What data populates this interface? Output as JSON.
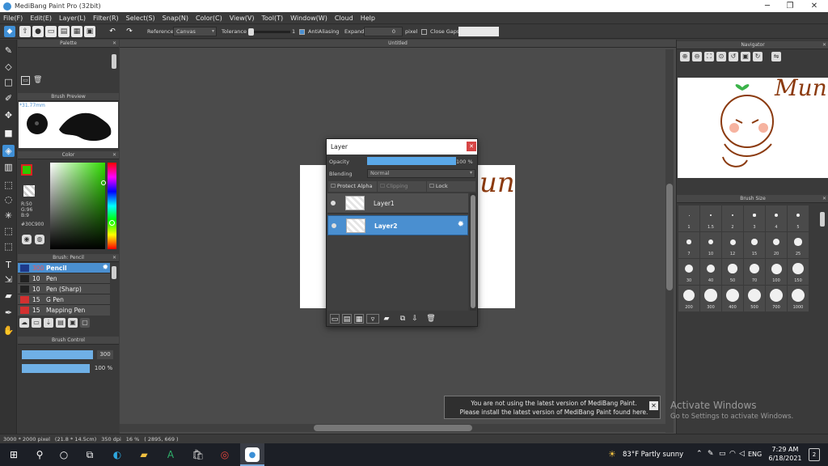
{
  "window": {
    "title": "MediBang Paint Pro (32bit)",
    "minimize": "─",
    "restore": "❐",
    "close": "✕"
  },
  "menu": [
    "File(F)",
    "Edit(E)",
    "Layer(L)",
    "Filter(R)",
    "Select(S)",
    "Snap(N)",
    "Color(C)",
    "View(V)",
    "Tool(T)",
    "Window(W)",
    "Cloud",
    "Help"
  ],
  "toolbar": {
    "reference_label": "Reference",
    "reference_value": "Canvas",
    "tolerance_label": "Tolerance",
    "tolerance_value": "1",
    "antialiasing_label": "AntiAliasing",
    "expand_label": "Expand",
    "expand_value": "0",
    "pixel_label": "pixel",
    "close_gaps_label": "Close Gaps"
  },
  "panels": {
    "palette": "Palette",
    "brush_preview": "Brush Preview",
    "brush_preview_size": "*31.77mm",
    "color": "Color",
    "color_values": {
      "r": "R:50",
      "g": "G:96",
      "b": "B:9",
      "hex": "#30C900"
    },
    "brush": "Brush: Pencil",
    "brush_control": "Brush Control",
    "navigator": "Navigator",
    "brush_size": "Brush Size",
    "untitled": "Untitled"
  },
  "brushes": [
    {
      "size": "300",
      "name": "Pencil",
      "color": "#1e3a8a",
      "selected": true
    },
    {
      "size": "10",
      "name": "Pen",
      "color": "#222222",
      "selected": false
    },
    {
      "size": "10",
      "name": "Pen (Sharp)",
      "color": "#222222",
      "selected": false
    },
    {
      "size": "15",
      "name": "G Pen",
      "color": "#d23030",
      "selected": false
    },
    {
      "size": "15",
      "name": "Mapping Pen",
      "color": "#d23030",
      "selected": false
    }
  ],
  "brush_control": {
    "size_value": "300",
    "opacity_value": "100 %",
    "size_level": 1.0,
    "opacity_level": 1.0
  },
  "layer_dialog": {
    "title": "Layer",
    "opacity_label": "Opacity",
    "opacity_value": "100 %",
    "opacity_level": 1.0,
    "blending_label": "Blending",
    "blending_value": "Normal",
    "protect_alpha": "Protect Alpha",
    "clipping": "Clipping",
    "lock": "Lock",
    "layers": [
      {
        "name": "Layer1",
        "selected": false
      },
      {
        "name": "Layer2",
        "selected": true
      }
    ]
  },
  "canvas_text": "un",
  "navigator_text": "Mun",
  "brush_sizes": [
    [
      "1",
      "1.5",
      "2",
      "3",
      "4",
      "5"
    ],
    [
      "7",
      "10",
      "12",
      "15",
      "20",
      "25"
    ],
    [
      "30",
      "40",
      "50",
      "70",
      "100",
      "150"
    ],
    [
      "200",
      "300",
      "400",
      "500",
      "700",
      "1000"
    ]
  ],
  "status": {
    "dimensions": "3000 * 2000 pixel",
    "size_cm": "(21.8 * 14.5cm)",
    "dpi": "350 dpi",
    "zoom": "16 %",
    "coords": "( 2895, 669 )"
  },
  "notice": {
    "line1": "You are not using the latest version of MediBang Paint.",
    "line2": "Please install the latest version of MediBang Paint found here."
  },
  "watermark": {
    "line1": "Activate Windows",
    "line2": "Go to Settings to activate Windows."
  },
  "taskbar": {
    "weather": "83°F  Partly sunny",
    "lang": "ENG",
    "time": "7:29 AM",
    "date": "6/18/2021",
    "notif_count": "2"
  },
  "colors": {
    "accent": "#3f8fd6",
    "selected_row": "#4a8fd0",
    "drawing_brown": "#8b3a0f",
    "fg_color": "#30c900"
  }
}
